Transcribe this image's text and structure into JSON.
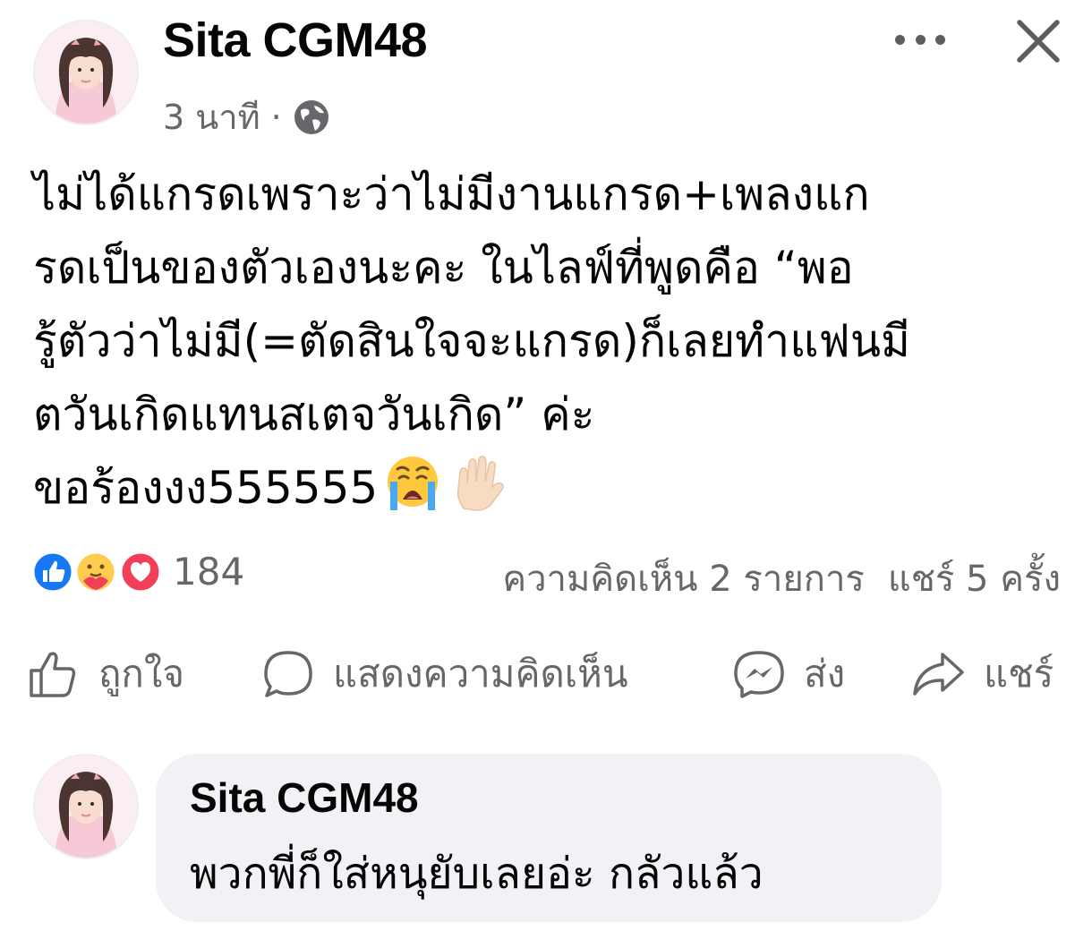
{
  "post": {
    "author": "Sita CGM48",
    "time": "3 นาที",
    "separator": "·",
    "audience_icon": "globe-icon",
    "body_lines": [
      "ไม่ได้แกรดเพราะว่าไม่มีงานแกรด+เพลงแก",
      "รดเป็นของตัวเองนะคะ ในไลฟ์ที่พูดคือ “พอ",
      "รู้ตัวว่าไม่มี(=ตัดสินใจจะแกรด)ก็เลยทำแฟนมี",
      "ตวันเกิดแทนสเตจวันเกิด” ค่ะ",
      "ขอร้องงง555555"
    ],
    "body_emojis": [
      "loudly-crying-face-emoji",
      "raised-hand-emoji"
    ]
  },
  "reactions": {
    "icons": [
      "like-reaction-icon",
      "care-reaction-icon",
      "love-reaction-icon"
    ],
    "count": "184",
    "comments": "ความคิดเห็น 2 รายการ",
    "shares": "แชร์ 5 ครั้ง"
  },
  "actions": {
    "like": "ถูกใจ",
    "comment": "แสดงความคิดเห็น",
    "send": "ส่ง",
    "share": "แชร์"
  },
  "comment": {
    "author": "Sita CGM48",
    "text": "พวกพี่ก็ใส่หนุยับเลยอ่ะ กลัวแล้ว"
  },
  "colors": {
    "text": "#050505",
    "secondary_text": "#65676b",
    "bubble": "#f0f2f5",
    "like_blue": "#1877f2",
    "love_red": "#f33e58"
  }
}
